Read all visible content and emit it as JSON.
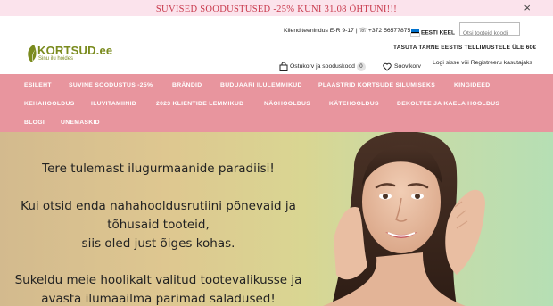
{
  "promo": {
    "text": "SUVISED SOODUSTUSED -25% KUNI 31.08 ÕHTUNI!!!",
    "close_icon": "×"
  },
  "header": {
    "logo": {
      "name": "KORTSUD.ee",
      "tagline": "Sinu ilu hoides",
      "color": "#7a8b1e"
    },
    "contact": "Klienditeenindus E-R 9-17 | ☏ +372 56577875",
    "language": {
      "label": "EESTI KEEL",
      "flag": "estonian-flag-icon"
    },
    "search": {
      "placeholder": "Otsi tooteid koodi"
    },
    "shipping": "TASUTA TARNE EESTIS TELLIMUSTELE ÜLE 60€",
    "cart": {
      "label": "Ostukorv ja sooduskood",
      "count": "0",
      "icon": "shopping-bag-icon"
    },
    "wishlist": {
      "label": "Soovikorv",
      "icon": "heart-icon"
    },
    "auth": "Logi sisse või Registreeru kasutajaks"
  },
  "nav": {
    "color": "#e8959e",
    "items": [
      "ESILEHT",
      "SUVINE SOODUSTUS -25%",
      "BRÄNDID",
      "BUDUAARI ILULEMMIKUD",
      "PLAASTRID KORTSUDE SILUMISEKS",
      "KINGIDEED",
      "KEHAHOOLDUS",
      "ILUVITAMIINID",
      "2023 KLIENTIDE LEMMIKUD",
      "NÄOHOOLDUS",
      "KÄTEHOOLDUS",
      "DEKOLTEE JA KAELA HOOLDUS",
      "BLOGI",
      "UNEMASKID"
    ]
  },
  "hero": {
    "lines": [
      "Tere tulemast ilugurmaanide paradiisi!",
      "Kui otsid enda nahahooldusrutiini põnevaid ja",
      "tõhusaid tooteid,",
      "siis oled just õiges kohas.",
      "Sukeldu meie hoolikalt valitud tootevalikusse ja",
      "avasta ilumaailma parimad saladused!"
    ],
    "image": "smiling-woman-portrait"
  }
}
